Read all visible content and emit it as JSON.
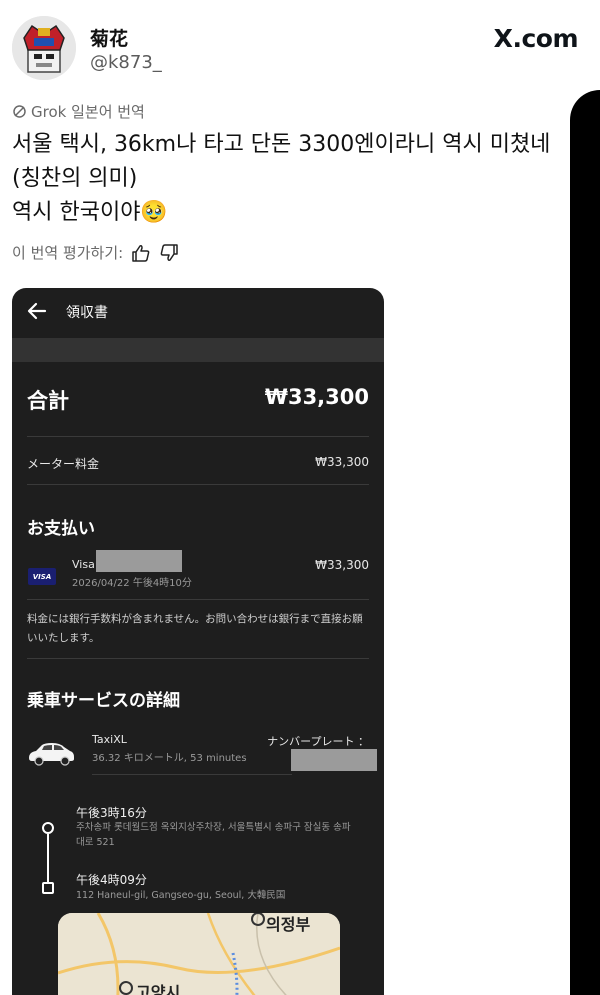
{
  "tweet": {
    "display_name": "菊花",
    "handle": "@k873_",
    "site_logo": "X.com",
    "translation_label": "Grok 일본어 번역",
    "lines": [
      "서울 택시, 36km나 타고 단돈 3300엔이라니 역시 미쳤네",
      "(칭찬의 의미)",
      "역시 한국이야🥹"
    ],
    "rate_label": "이 번역 평가하기:"
  },
  "receipt": {
    "title": "領収書",
    "total_label": "合計",
    "total_value": "₩33,300",
    "meter_label": "メーター料金",
    "meter_value": "₩33,300",
    "payment_section": "お支払い",
    "card_brand": "VISA",
    "card_name": "Visa",
    "payment_datetime": "2026/04/22 午後4時10分",
    "payment_value": "₩33,300",
    "note": "料金には銀行手数料が含まれません。お問い合わせは銀行まで直接お願いいたします。",
    "ride_section": "乗車サービスの詳細",
    "vehicle_type": "TaxiXL",
    "distance": "36.32 キロメートル, 53 minutes",
    "plate_label": "ナンバープレート ：",
    "pickup_time": "午後3時16分",
    "pickup_address": "주차송파 롯데월드점 옥외지상주차장, 서울특별시 송파구 잠실동 송파대로 521",
    "dropoff_time": "午後4時09分",
    "dropoff_address": "112 Haneul-gil, Gangseo-gu, Seoul, 大韓民国",
    "map_labels": [
      "의정부",
      "고양시"
    ]
  },
  "icons": {
    "back": "arrow-left-icon",
    "thumbs_up": "thumbs-up-icon",
    "thumbs_down": "thumbs-down-icon",
    "grok": "grok-icon"
  },
  "colors": {
    "receipt_bg": "#1e1e1e",
    "text_secondary": "#6a6a6a",
    "visa_blue": "#1a1f71"
  }
}
